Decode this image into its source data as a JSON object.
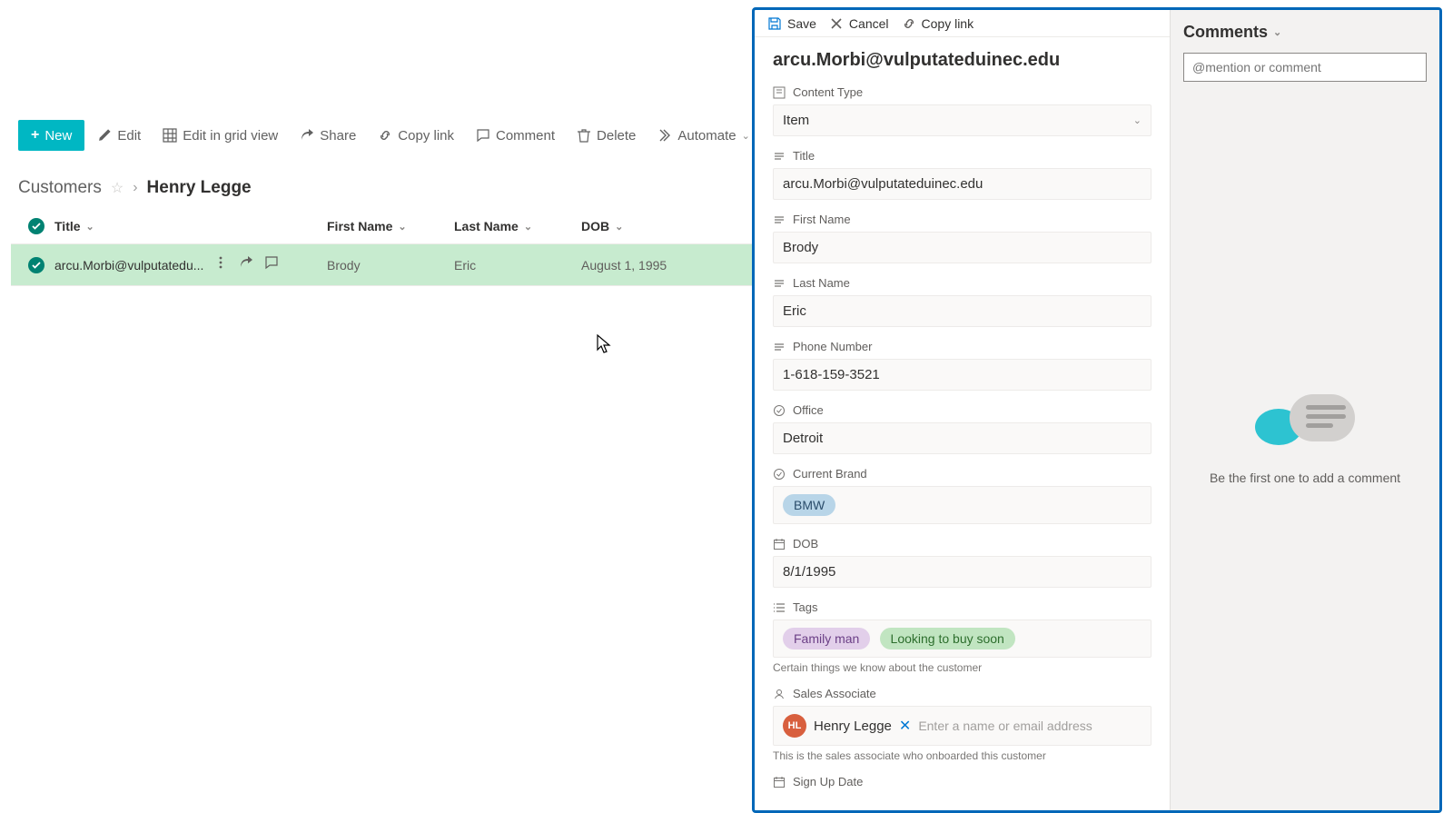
{
  "toolbar": {
    "new_label": "New",
    "edit_label": "Edit",
    "grid_label": "Edit in grid view",
    "share_label": "Share",
    "copy_label": "Copy link",
    "comment_label": "Comment",
    "delete_label": "Delete",
    "automate_label": "Automate"
  },
  "breadcrumb": {
    "list_name": "Customers",
    "current": "Henry Legge"
  },
  "columns": {
    "title": "Title",
    "first_name": "First Name",
    "last_name": "Last Name",
    "dob": "DOB"
  },
  "row": {
    "title": "arcu.Morbi@vulputatedu...",
    "first_name": "Brody",
    "last_name": "Eric",
    "dob": "August 1, 1995"
  },
  "panel": {
    "save": "Save",
    "cancel": "Cancel",
    "copy": "Copy link",
    "item_title": "arcu.Morbi@vulputateduinec.edu",
    "fields": {
      "content_type_label": "Content Type",
      "content_type_value": "Item",
      "title_label": "Title",
      "title_value": "arcu.Morbi@vulputateduinec.edu",
      "first_name_label": "First Name",
      "first_name_value": "Brody",
      "last_name_label": "Last Name",
      "last_name_value": "Eric",
      "phone_label": "Phone Number",
      "phone_value": "1-618-159-3521",
      "office_label": "Office",
      "office_value": "Detroit",
      "brand_label": "Current Brand",
      "brand_value": "BMW",
      "dob_label": "DOB",
      "dob_value": "8/1/1995",
      "tags_label": "Tags",
      "tags_1": "Family man",
      "tags_2": "Looking to buy soon",
      "tags_desc": "Certain things we know about the customer",
      "associate_label": "Sales Associate",
      "associate_initials": "HL",
      "associate_name": "Henry Legge",
      "associate_placeholder": "Enter a name or email address",
      "associate_desc": "This is the sales associate who onboarded this customer",
      "signup_label": "Sign Up Date"
    }
  },
  "comments": {
    "header": "Comments",
    "placeholder": "@mention or comment",
    "empty": "Be the first one to add a comment"
  }
}
